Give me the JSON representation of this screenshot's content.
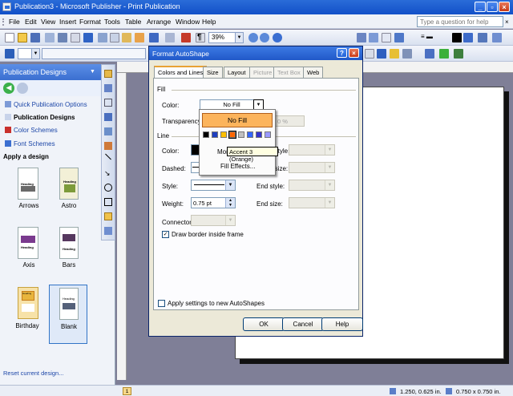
{
  "window": {
    "title": "Publication3 - Microsoft Publisher - Print Publication"
  },
  "menu": {
    "items": [
      "File",
      "Edit",
      "View",
      "Insert",
      "Format",
      "Tools",
      "Table",
      "Arrange",
      "Window",
      "Help"
    ],
    "ask_placeholder": "Type a question for help"
  },
  "toolbar": {
    "zoom": "39%"
  },
  "task_pane": {
    "title": "Publication Designs",
    "links": [
      "Quick Publication Options",
      "Publication Designs",
      "Color Schemes",
      "Font Schemes"
    ],
    "apply_label": "Apply a design",
    "designs": [
      "Arrows",
      "Astro",
      "Axis",
      "Bars",
      "Birthday",
      "Blank"
    ],
    "thumb_heading": "Heading",
    "reset_link": "Reset current design..."
  },
  "dialog": {
    "title": "Format AutoShape",
    "tabs": [
      "Colors and Lines",
      "Size",
      "Layout",
      "Picture",
      "Text Box",
      "Web"
    ],
    "fill_section": "Fill",
    "color_label": "Color:",
    "color_value": "No Fill",
    "transparency_label": "Transparency:",
    "transparency_value": "0 %",
    "line_section": "Line",
    "line_labels": {
      "color": "Color:",
      "dashed": "Dashed:",
      "style": "Style:",
      "weight": "Weight:",
      "connector": "Connector:",
      "begin_style": "Begin style:",
      "begin_size": "Begin size:",
      "end_style": "End style:",
      "end_size": "End size:"
    },
    "weight_value": "0.75 pt",
    "draw_border_label": "Draw border inside frame",
    "draw_border_checked": true,
    "apply_new_label": "Apply settings to new AutoShapes",
    "apply_new_checked": false,
    "buttons": {
      "ok": "OK",
      "cancel": "Cancel",
      "help": "Help"
    }
  },
  "color_popup": {
    "no_fill": "No Fill",
    "swatches": [
      "#000000",
      "#1f3fbf",
      "#ffc000",
      "#ff6600",
      "#c0c0c0",
      "#3366ff",
      "#3333cc",
      "#9999ff"
    ],
    "more_colors": "More Colors...",
    "fill_effects": "Fill Effects...",
    "tooltip": "Accent 3 (Orange)"
  },
  "status": {
    "position": "1.250, 0.625 in.",
    "size": "0.750 x 0.750 in.",
    "page": "1"
  }
}
